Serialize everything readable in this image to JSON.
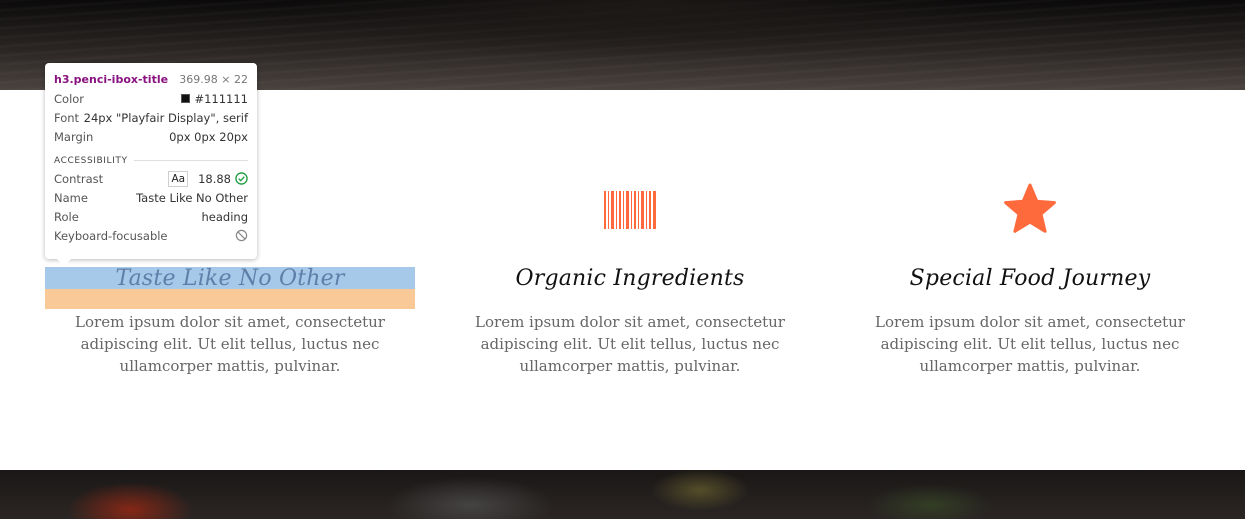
{
  "colors": {
    "accent": "#ff6a3d",
    "title": "#111111",
    "body_text": "#666666",
    "highlight_content": "#6fa8dc",
    "highlight_margin": "#f6b26b"
  },
  "features": [
    {
      "icon": "barcode-icon",
      "title": "Taste Like No Other",
      "text": "Lorem ipsum dolor sit amet, consectetur adipiscing elit. Ut elit tellus, luctus nec ullamcorper mattis, pulvinar."
    },
    {
      "icon": "barcode-icon",
      "title": "Organic Ingredients",
      "text": "Lorem ipsum dolor sit amet, consectetur adipiscing elit. Ut elit tellus, luctus nec ullamcorper mattis, pulvinar."
    },
    {
      "icon": "star-icon",
      "title": "Special Food Journey",
      "text": "Lorem ipsum dolor sit amet, consectetur adipiscing elit. Ut elit tellus, luctus nec ullamcorper mattis, pulvinar."
    }
  ],
  "inspector": {
    "selector": "h3.penci-ibox-title",
    "dimensions": "369.98 × 22",
    "rows": [
      {
        "label": "Color",
        "value": "#111111"
      },
      {
        "label": "Font",
        "value": "24px \"Playfair Display\", serif"
      },
      {
        "label": "Margin",
        "value": "0px 0px 20px"
      }
    ],
    "section_title": "ACCESSIBILITY",
    "contrast_label": "Contrast",
    "contrast_badge": "Aa",
    "contrast_value": "18.88",
    "name_label": "Name",
    "name_value": "Taste Like No Other",
    "role_label": "Role",
    "role_value": "heading",
    "keyboard_label": "Keyboard-focusable"
  }
}
